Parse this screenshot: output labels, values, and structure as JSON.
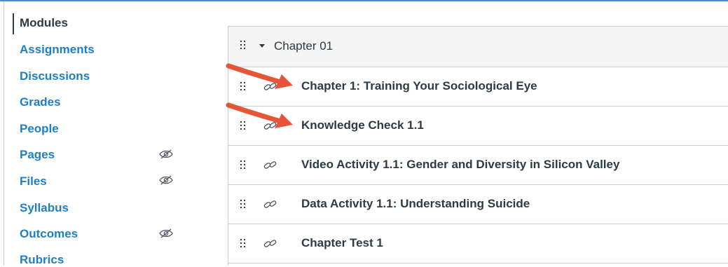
{
  "sidebar": {
    "items": [
      {
        "label": "Modules",
        "active": true,
        "hidden_icon": false
      },
      {
        "label": "Assignments",
        "active": false,
        "hidden_icon": false
      },
      {
        "label": "Discussions",
        "active": false,
        "hidden_icon": false
      },
      {
        "label": "Grades",
        "active": false,
        "hidden_icon": false
      },
      {
        "label": "People",
        "active": false,
        "hidden_icon": false
      },
      {
        "label": "Pages",
        "active": false,
        "hidden_icon": true
      },
      {
        "label": "Files",
        "active": false,
        "hidden_icon": true
      },
      {
        "label": "Syllabus",
        "active": false,
        "hidden_icon": false
      },
      {
        "label": "Outcomes",
        "active": false,
        "hidden_icon": true
      },
      {
        "label": "Rubrics",
        "active": false,
        "hidden_icon": false
      }
    ]
  },
  "module": {
    "title": "Chapter 01",
    "items": [
      {
        "title": "Chapter 1: Training Your Sociological Eye",
        "icon": "link-icon",
        "highlighted": true
      },
      {
        "title": "Knowledge Check 1.1",
        "icon": "link-icon",
        "highlighted": true
      },
      {
        "title": "Video Activity 1.1: Gender and Diversity in Silicon Valley",
        "icon": "link-icon",
        "highlighted": false
      },
      {
        "title": "Data Activity 1.1: Understanding Suicide",
        "icon": "link-icon",
        "highlighted": false
      },
      {
        "title": "Chapter Test 1",
        "icon": "link-icon",
        "highlighted": false
      }
    ]
  },
  "colors": {
    "link": "#1f7fc5",
    "text": "#2d3b45",
    "arrow": "#e4553a",
    "border": "#c7cdd1",
    "header_bg": "#f5f5f5"
  }
}
